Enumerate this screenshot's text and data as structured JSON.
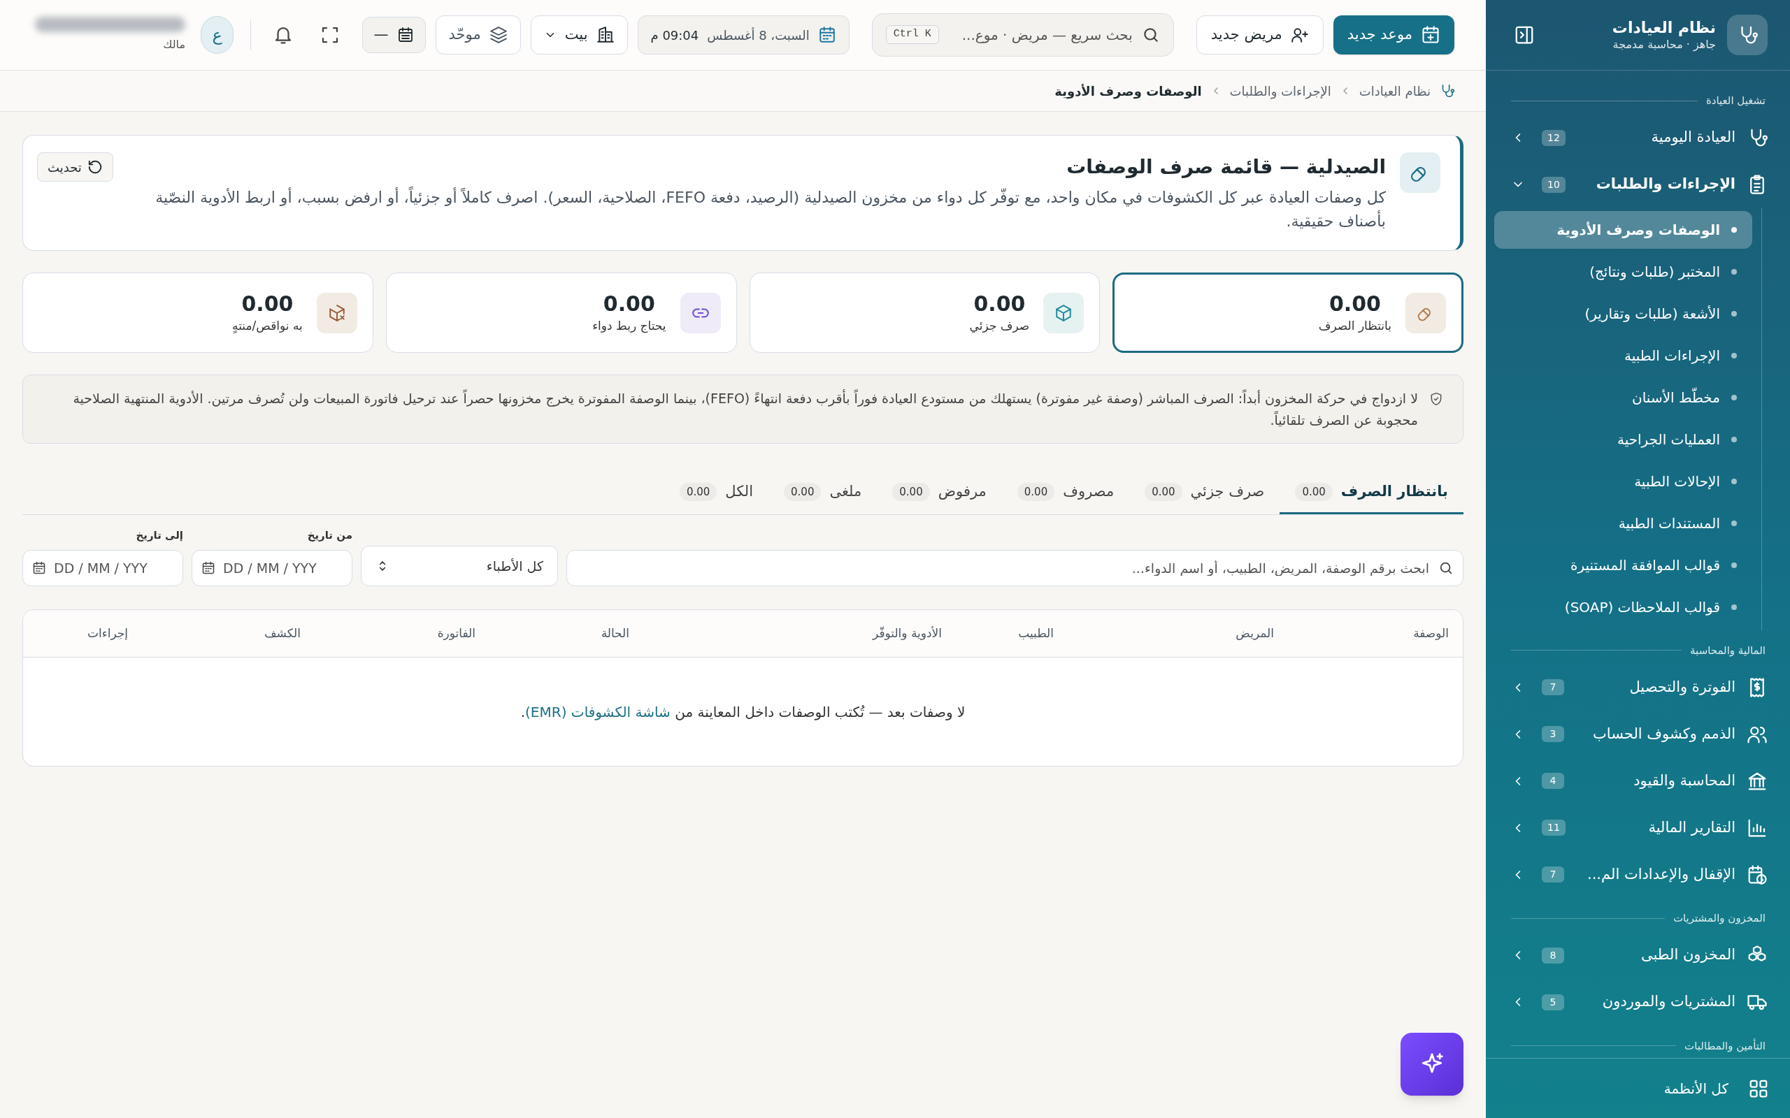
{
  "sidebar": {
    "title": "نظام العيادات",
    "subtitle": "جاهز · محاسبة مدمجة",
    "sections": [
      {
        "label": "تشغيل العيادة",
        "items": [
          {
            "label": "العيادة اليومية",
            "badge": "12",
            "expanded": false
          },
          {
            "label": "الإجراءات والطلبات",
            "badge": "10",
            "expanded": true,
            "children": [
              {
                "label": "الوصفات وصرف الأدوية",
                "selected": true
              },
              {
                "label": "المختبر (طلبات ونتائج)",
                "selected": false
              },
              {
                "label": "الأشعة (طلبات وتقارير)",
                "selected": false
              },
              {
                "label": "الإجراءات الطبية",
                "selected": false
              },
              {
                "label": "مخطّط الأسنان",
                "selected": false
              },
              {
                "label": "العمليات الجراحية",
                "selected": false
              },
              {
                "label": "الإحالات الطبية",
                "selected": false
              },
              {
                "label": "المستندات الطبية",
                "selected": false
              },
              {
                "label": "قوالب الموافقة المستنيرة",
                "selected": false
              },
              {
                "label": "قوالب الملاحظات (SOAP)",
                "selected": false
              }
            ]
          }
        ]
      },
      {
        "label": "المالية والمحاسبة",
        "items": [
          {
            "label": "الفوترة والتحصيل",
            "badge": "7",
            "expanded": false
          },
          {
            "label": "الذمم وكشوف الحساب",
            "badge": "3",
            "expanded": false
          },
          {
            "label": "المحاسبة والقيود",
            "badge": "4",
            "expanded": false
          },
          {
            "label": "التقارير المالية",
            "badge": "11",
            "expanded": false
          },
          {
            "label": "الإقفال والإعدادات الم...",
            "badge": "7",
            "expanded": false
          }
        ]
      },
      {
        "label": "المخزون والمشتريات",
        "items": [
          {
            "label": "المخزون الطبى",
            "badge": "8",
            "expanded": false
          },
          {
            "label": "المشتريات والموردون",
            "badge": "5",
            "expanded": false
          }
        ]
      },
      {
        "label": "التأمين والمطالبات"
      }
    ],
    "footer": "كل الأنظمة"
  },
  "topbar": {
    "new_appointment": "موعد جديد",
    "new_patient": "مريض جديد",
    "search": {
      "placeholder": "بحث سريع — مريض · موع...",
      "shortcut": "Ctrl K"
    },
    "date": "السبت، 8 أغسطس",
    "time": "09:04 م",
    "branch": "بيت",
    "view": "موحّد",
    "period": "—",
    "avatar": "ع",
    "role": "مالك"
  },
  "breadcrumb": [
    "نظام العيادات",
    "الإجراءات والطلبات",
    "الوصفات وصرف الأدوية"
  ],
  "header": {
    "title": "الصيدلية — قائمة صرف الوصفات",
    "description": "كل وصفات العيادة عبر كل الكشوفات في مكان واحد، مع توفّر كل دواء من مخزون الصيدلية (الرصيد، دفعة FEFO، الصلاحية، السعر). اصرف كاملاً أو جزئياً، أو ارفض بسبب، أو اربط الأدوية النصّية بأصناف حقيقية.",
    "refresh": "تحديث"
  },
  "stats": [
    {
      "kind": "pill",
      "value": "0.00",
      "label": "بانتظار الصرف",
      "selected": true
    },
    {
      "kind": "box",
      "value": "0.00",
      "label": "صرف جزئي",
      "selected": false
    },
    {
      "kind": "link",
      "value": "0.00",
      "label": "يحتاج ربط دواء",
      "selected": false
    },
    {
      "kind": "boxx",
      "value": "0.00",
      "label": "به نواقص/منتهٍ",
      "selected": false
    }
  ],
  "notice": "لا ازدواج في حركة المخزون أبداً: الصرف المباشر (وصفة غير مفوترة) يستهلك من مستودع العيادة فوراً بأقرب دفعة انتهاءً (FEFO)، بينما الوصفة المفوترة يخرج مخزونها حصراً عند ترحيل فاتورة المبيعات ولن تُصرف مرتين. الأدوية المنتهية الصلاحية محجوبة عن الصرف تلقائياً.",
  "tabs": [
    {
      "label": "بانتظار الصرف",
      "count": "0.00",
      "selected": true
    },
    {
      "label": "صرف جزئي",
      "count": "0.00",
      "selected": false
    },
    {
      "label": "مصروف",
      "count": "0.00",
      "selected": false
    },
    {
      "label": "مرفوض",
      "count": "0.00",
      "selected": false
    },
    {
      "label": "ملغى",
      "count": "0.00",
      "selected": false
    },
    {
      "label": "الكل",
      "count": "0.00",
      "selected": false
    }
  ],
  "filters": {
    "search_placeholder": "ابحث برقم الوصفة، المريض، الطبيب، أو اسم الدواء...",
    "doctor": "كل الأطباء",
    "from_label": "من تاريخ",
    "from_placeholder": "DD / MM / YYY",
    "to_label": "إلى تاريخ",
    "to_placeholder": "DD / MM / YYY"
  },
  "table": {
    "columns": [
      "الوصفة",
      "المريض",
      "الطبيب",
      "الأدوية والتوفّر",
      "الحالة",
      "الفاتورة",
      "الكشف",
      "إجراءات"
    ],
    "empty_text": "لا وصفات بعد — تُكتب الوصفات داخل المعاينة من ",
    "empty_link": "شاشة الكشوفات (EMR)",
    "empty_end": "."
  }
}
